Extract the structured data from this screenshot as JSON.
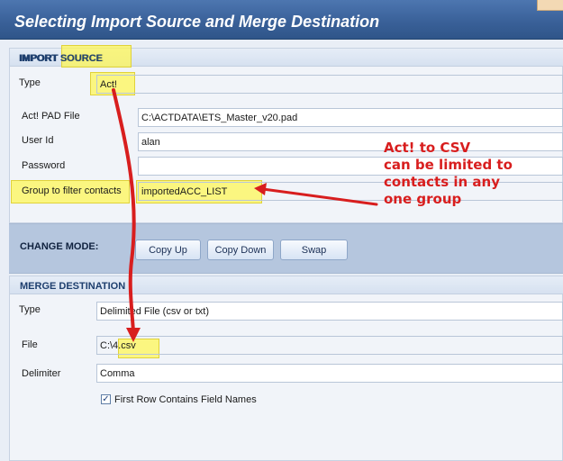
{
  "window": {
    "title": "Selecting Import Source and Merge Destination"
  },
  "import_source": {
    "header": "IMPORT SOURCE",
    "type_label": "Type",
    "type_value": "Act!",
    "pad_file_label": "Act! PAD File",
    "pad_file_value": "C:\\ACTDATA\\ETS_Master_v20.pad",
    "user_id_label": "User Id",
    "user_id_value": "alan",
    "password_label": "Password",
    "password_value": "",
    "group_label": "Group to filter contacts",
    "group_value": "importedACC_LIST"
  },
  "change_mode": {
    "label": "CHANGE MODE:",
    "copy_up": "Copy Up",
    "copy_down": "Copy Down",
    "swap": "Swap"
  },
  "merge_destination": {
    "header": "MERGE DESTINATION",
    "type_label": "Type",
    "type_value": "Delimited File (csv or txt)",
    "file_label": "File",
    "file_value": "C:\\4.csv",
    "delimiter_label": "Delimiter",
    "delimiter_value": "Comma",
    "first_row_label": "First Row Contains Field Names",
    "first_row_checked": true
  },
  "annotation": {
    "lines": [
      "Act! to CSV",
      "can be limited to",
      "contacts in any",
      "one group"
    ]
  },
  "colors": {
    "title_bar": "#3a6199",
    "highlight": "#fff750",
    "annotation_red": "#d81e1e",
    "mode_strip": "#b5c6de"
  },
  "icons": [
    "check-icon",
    "arrow-icon"
  ]
}
